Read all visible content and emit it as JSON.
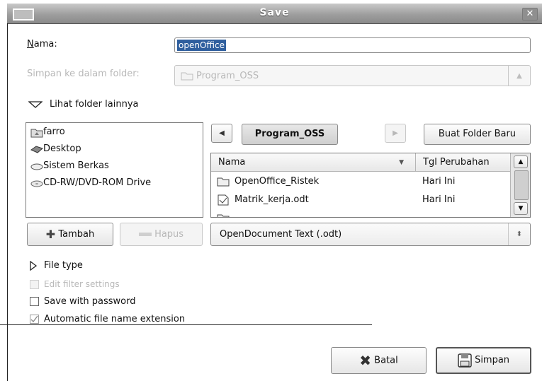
{
  "window": {
    "title": "Save"
  },
  "name_row": {
    "label": "Nama:",
    "value": "openOffice"
  },
  "save_in": {
    "label": "Simpan ke dalam folder:",
    "value": "Program_OSS"
  },
  "browse_toggle": {
    "label": "Lihat folder lainnya"
  },
  "places": [
    {
      "label": "farro",
      "icon": "home-folder-icon"
    },
    {
      "label": "Desktop",
      "icon": "desktop-icon"
    },
    {
      "label": "Sistem Berkas",
      "icon": "drive-icon"
    },
    {
      "label": "CD-RW/DVD-ROM Drive",
      "icon": "cdrom-icon"
    }
  ],
  "path_bar": {
    "current": "Program_OSS",
    "create_folder": "Buat Folder Baru"
  },
  "file_list": {
    "columns": [
      "Nama",
      "Tgl Perubahan"
    ],
    "rows": [
      {
        "name": "OpenOffice_Ristek",
        "modified": "Hari Ini",
        "icon": "folder-icon"
      },
      {
        "name": "Matrik_kerja.odt",
        "modified": "Hari Ini",
        "icon": "document-icon"
      },
      {
        "name": "",
        "modified": "",
        "icon": "folder-icon"
      }
    ]
  },
  "places_buttons": {
    "add": "Tambah",
    "remove": "Hapus"
  },
  "filter": {
    "value": "OpenDocument Text (.odt)"
  },
  "file_type": {
    "label": "File type"
  },
  "options": {
    "edit_filter": {
      "label": "Edit filter settings",
      "checked": false,
      "enabled": false
    },
    "save_password": {
      "label": "Save with password",
      "checked": false,
      "enabled": true
    },
    "auto_ext": {
      "label": "Automatic file name extension",
      "checked": true,
      "enabled": true
    }
  },
  "actions": {
    "cancel": "Batal",
    "save": "Simpan"
  },
  "colors": {
    "selection": "#2f5f9e",
    "titlebar": "#9e9e9e"
  }
}
